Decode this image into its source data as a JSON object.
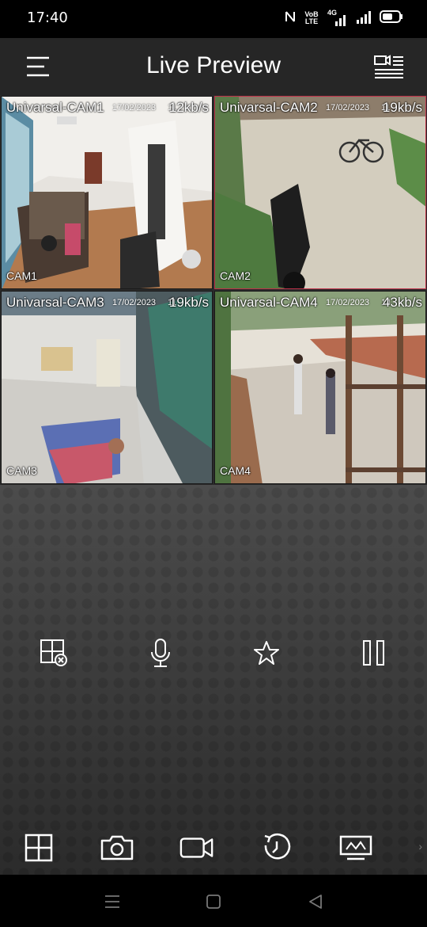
{
  "status_bar": {
    "time": "17:40",
    "icons": [
      "nfc-icon",
      "volte-icon",
      "signal-4g-icon",
      "signal-icon",
      "battery-icon"
    ],
    "volte_label": "VoB LTE",
    "network_label": "4G"
  },
  "header": {
    "title": "Live Preview",
    "menu_icon": "hamburger-icon",
    "camera_list_icon": "camera-list-icon"
  },
  "cameras": [
    {
      "name": "Univarsal-CAM1",
      "date": "17/02/2023",
      "overlap_text": "11",
      "bitrate": "12kb/s",
      "label": "CAM1",
      "selected": false
    },
    {
      "name": "Univarsal-CAM2",
      "date": "17/02/2023",
      "overlap_text": "11",
      "bitrate": "19kb/s",
      "label": "CAM2",
      "selected": true
    },
    {
      "name": "Univarsal-CAM3",
      "date": "17/02/2023",
      "overlap_text": "11",
      "bitrate": "19kb/s",
      "label": "CAM3",
      "selected": false
    },
    {
      "name": "Univarsal-CAM4",
      "date": "17/02/2023",
      "overlap_text": "14",
      "bitrate": "43kb/s",
      "label": "CAM4",
      "selected": false
    }
  ],
  "controls": {
    "mid_row": [
      "close-window-icon",
      "microphone-icon",
      "favorite-star-icon",
      "pause-icon"
    ],
    "bottom_row": [
      "split-grid-icon",
      "snapshot-camera-icon",
      "record-video-icon",
      "playback-icon",
      "display-monitor-icon"
    ],
    "more_glyph": "›"
  },
  "nav_bar": [
    "recents-menu-icon",
    "home-square-icon",
    "back-triangle-icon"
  ],
  "colors": {
    "header_bg": "#262626",
    "selected_border": "#c0314a",
    "control_bg": "#474747"
  }
}
